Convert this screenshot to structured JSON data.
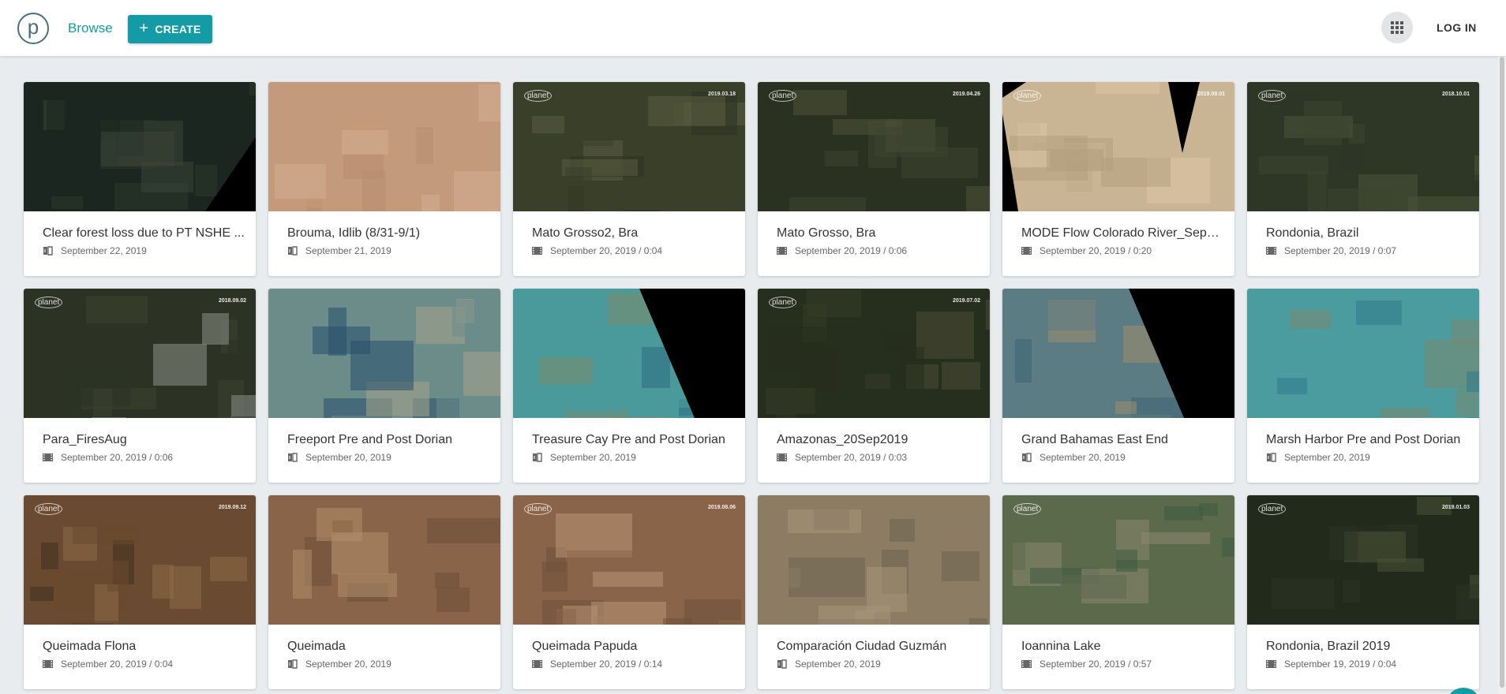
{
  "header": {
    "logo_letter": "p",
    "browse_label": "Browse",
    "create_label": "CREATE",
    "apps_icon": "apps-grid-icon",
    "login_label": "LOG IN"
  },
  "colors": {
    "accent": "#139ba6"
  },
  "cards": [
    {
      "title": "Clear forest loss due to PT NSHE ...",
      "date": "September 22, 2019",
      "icon": "story-icon",
      "palette": [
        "#1c2620",
        "#2b382c",
        "#3a4636"
      ],
      "dark": "wedge",
      "watermark": false
    },
    {
      "title": "Brouma, Idlib (8/31-9/1)",
      "date": "September 21, 2019",
      "icon": "story-icon",
      "palette": [
        "#c49a7c",
        "#d3ad90",
        "#b88e70"
      ],
      "dark": "",
      "watermark": false
    },
    {
      "title": "Mato Grosso2, Bra",
      "date": "September 20, 2019 / 0:04",
      "icon": "video-icon",
      "palette": [
        "#3a3f2a",
        "#5a5c3e",
        "#2b3222"
      ],
      "dark": "",
      "watermark": true,
      "stamp": "2019.03.18"
    },
    {
      "title": "Mato Grosso, Bra",
      "date": "September 20, 2019 / 0:06",
      "icon": "video-icon",
      "palette": [
        "#2a3120",
        "#3c4430",
        "#4c5238"
      ],
      "dark": "",
      "watermark": true,
      "stamp": "2019.04.26"
    },
    {
      "title": "MODE Flow Colorado River_Sep_...",
      "date": "September 20, 2019 / 0:20",
      "icon": "video-icon",
      "palette": [
        "#c9b494",
        "#b39e7e",
        "#dcc7a6"
      ],
      "dark": "sides",
      "watermark": true,
      "stamp": "2019.09.01"
    },
    {
      "title": "Rondonia, Brazil",
      "date": "September 20, 2019 / 0:07",
      "icon": "video-icon",
      "palette": [
        "#2e3626",
        "#3b4530",
        "#4a5338"
      ],
      "dark": "",
      "watermark": true,
      "stamp": "2018.10.01"
    },
    {
      "title": "Para_FiresAug",
      "date": "September 20, 2019 / 0:06",
      "icon": "video-icon",
      "palette": [
        "#2c3324",
        "#3c4230",
        "#8c8f86"
      ],
      "dark": "",
      "watermark": true,
      "stamp": "2018.09.02"
    },
    {
      "title": "Freeport Pre and Post Dorian",
      "date": "September 20, 2019",
      "icon": "story-icon",
      "palette": [
        "#6c8c8a",
        "#264e6c",
        "#a8a48a"
      ],
      "dark": "",
      "watermark": false
    },
    {
      "title": "Treasure Cay Pre and Post Dorian",
      "date": "September 20, 2019",
      "icon": "story-icon",
      "palette": [
        "#4a9a9c",
        "#7a8a6a",
        "#2c6c80"
      ],
      "dark": "right",
      "watermark": false
    },
    {
      "title": "Amazonas_20Sep2019",
      "date": "September 20, 2019 / 0:03",
      "icon": "video-icon",
      "palette": [
        "#262e1e",
        "#343c28",
        "#4a4c34"
      ],
      "dark": "",
      "watermark": true,
      "stamp": "2019.07.02"
    },
    {
      "title": "Grand Bahamas East End",
      "date": "September 20, 2019",
      "icon": "story-icon",
      "palette": [
        "#5c7c84",
        "#a08c6c",
        "#3c6474"
      ],
      "dark": "right",
      "watermark": false
    },
    {
      "title": "Marsh Harbor Pre and Post Dorian",
      "date": "September 20, 2019",
      "icon": "story-icon",
      "palette": [
        "#4a9c9e",
        "#7a8870",
        "#2e7a8c"
      ],
      "dark": "",
      "watermark": false
    },
    {
      "title": "Queimada Flona",
      "date": "September 20, 2019 / 0:04",
      "icon": "video-icon",
      "palette": [
        "#6a4a30",
        "#8c6a48",
        "#3e3020"
      ],
      "dark": "",
      "watermark": true,
      "stamp": "2019.09.12"
    },
    {
      "title": "Queimada",
      "date": "September 20, 2019",
      "icon": "story-icon",
      "palette": [
        "#8a6448",
        "#6c4e38",
        "#b08e6e"
      ],
      "dark": "",
      "watermark": false
    },
    {
      "title": "Queimada Papuda",
      "date": "September 20, 2019 / 0:14",
      "icon": "video-icon",
      "palette": [
        "#8a6448",
        "#6e503a",
        "#b89474"
      ],
      "dark": "",
      "watermark": true,
      "stamp": "2019.08.06"
    },
    {
      "title": "Comparación Ciudad Guzmán",
      "date": "September 20, 2019",
      "icon": "story-icon",
      "palette": [
        "#8c7c64",
        "#6e624e",
        "#a89678"
      ],
      "dark": "",
      "watermark": false
    },
    {
      "title": "Ioannina Lake",
      "date": "September 20, 2019 / 0:57",
      "icon": "video-icon",
      "palette": [
        "#5c6a4c",
        "#3e5a40",
        "#8a8670"
      ],
      "dark": "",
      "watermark": true,
      "stamp": ""
    },
    {
      "title": "Rondonia, Brazil 2019",
      "date": "September 19, 2019 / 0:04",
      "icon": "video-icon",
      "palette": [
        "#222a1c",
        "#2c3424",
        "#4a5238"
      ],
      "dark": "",
      "watermark": true,
      "stamp": "2019.01.03"
    }
  ],
  "watermark_text": "planet"
}
